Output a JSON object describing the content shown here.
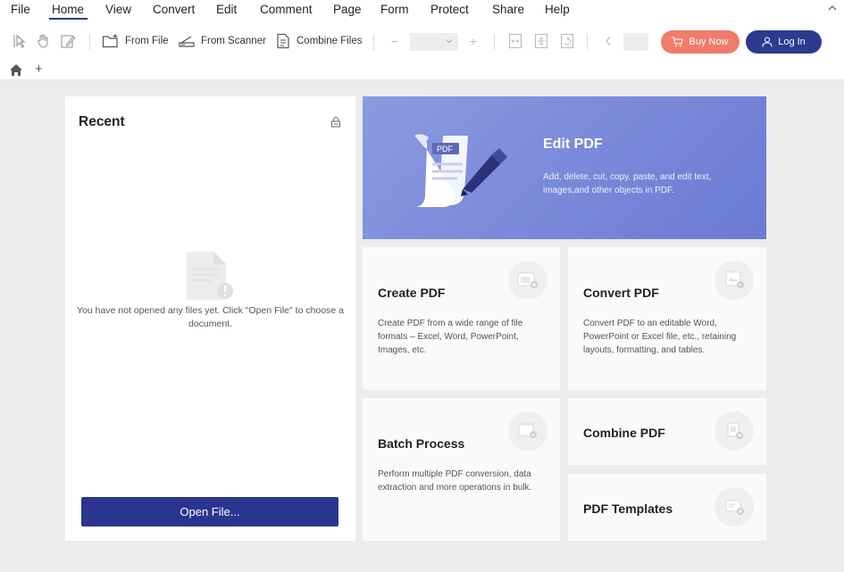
{
  "menu": {
    "items": [
      "File",
      "Home",
      "View",
      "Convert",
      "Edit",
      "Comment",
      "Page",
      "Form",
      "Protect",
      "Share",
      "Help"
    ],
    "active": "Home"
  },
  "toolbar": {
    "from_file": "From File",
    "from_scanner": "From Scanner",
    "combine_files": "Combine Files",
    "zoom_value": "",
    "page_value": "",
    "buy_now": "Buy Now",
    "log_in": "Log In"
  },
  "recent": {
    "title": "Recent",
    "empty_message": "You have not opened any files yet. Click \"Open File\" to choose a document.",
    "open_file": "Open File..."
  },
  "hero": {
    "title": "Edit PDF",
    "description": "Add, delete, cut, copy, paste, and edit text, images,and other objects in PDF.",
    "badge": "PDF"
  },
  "cards": {
    "create": {
      "title": "Create PDF",
      "description": "Create PDF from a wide range of file formats – Excel, Word, PowerPoint, Images, etc."
    },
    "convert": {
      "title": "Convert PDF",
      "description": "Convert PDF to an editable Word, PowerPoint or Excel file, etc., retaining layouts, formatting, and tables."
    },
    "batch": {
      "title": "Batch Process",
      "description": "Perform multiple PDF conversion, data extraction and more operations in bulk."
    },
    "combine": {
      "title": "Combine PDF"
    },
    "templates": {
      "title": "PDF Templates"
    }
  },
  "colors": {
    "brand": "#2a3590",
    "buy": "#f07c6b",
    "hero_start": "#8a9ae0",
    "hero_end": "#6b7ad4"
  },
  "icons": [
    "select-icon",
    "hand-icon",
    "edit-icon",
    "folder-add-icon",
    "scanner-icon",
    "combine-icon",
    "zoom-out-icon",
    "zoom-in-icon",
    "fit-width-icon",
    "fit-page-icon",
    "rotate-icon",
    "prev-page-icon",
    "cart-icon",
    "user-icon",
    "home-icon",
    "lock-icon",
    "document-icon"
  ]
}
